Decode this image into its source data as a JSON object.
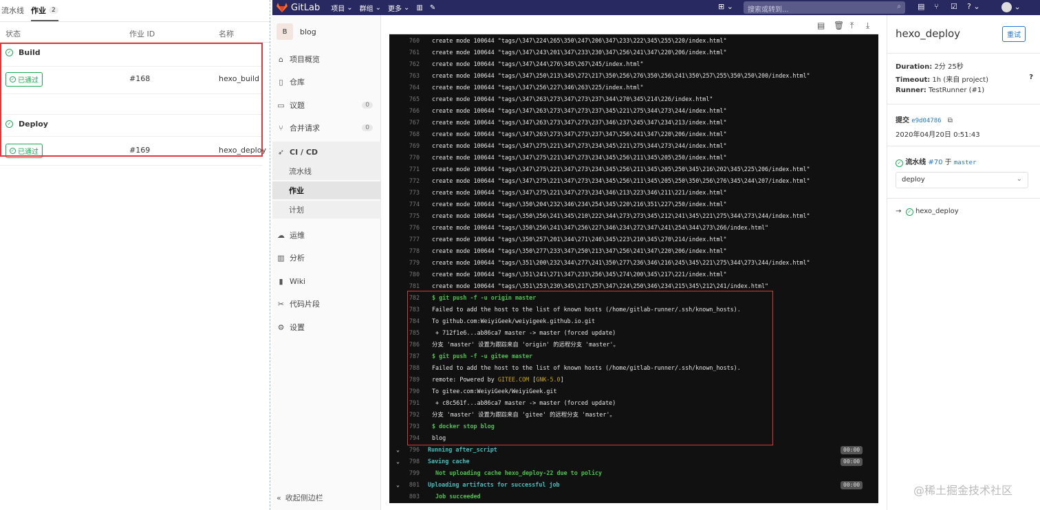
{
  "left": {
    "tabs": [
      {
        "label": "流水线"
      },
      {
        "label": "作业",
        "count": "2"
      }
    ],
    "headers": [
      "状态",
      "作业 ID",
      "名称"
    ],
    "stages": [
      {
        "name": "Build",
        "status": "已通过",
        "job_id": "#168",
        "job_name": "hexo_build"
      },
      {
        "name": "Deploy",
        "status": "已通过",
        "job_id": "#169",
        "job_name": "hexo_deploy"
      }
    ]
  },
  "topbar": {
    "brand": "GitLab",
    "menus": [
      "项目",
      "群组",
      "更多"
    ],
    "search_placeholder": "搜索或转到..."
  },
  "sidebar": {
    "project_initial": "B",
    "project_name": "blog",
    "items": [
      {
        "label": "项目概览",
        "icon": "home-icon"
      },
      {
        "label": "仓库",
        "icon": "doc-icon"
      },
      {
        "label": "议题",
        "icon": "issues-icon",
        "count": "0"
      },
      {
        "label": "合并请求",
        "icon": "merge-request-icon",
        "count": "0"
      },
      {
        "label": "CI / CD",
        "icon": "rocket-icon"
      }
    ],
    "subitems": [
      {
        "label": "流水线"
      },
      {
        "label": "作业"
      },
      {
        "label": "计划"
      }
    ],
    "items2": [
      {
        "label": "运维",
        "icon": "cloud-icon"
      },
      {
        "label": "分析",
        "icon": "chart-icon"
      },
      {
        "label": "Wiki",
        "icon": "book-icon"
      },
      {
        "label": "代码片段",
        "icon": "scissors-icon"
      },
      {
        "label": "设置",
        "icon": "gear-icon"
      }
    ],
    "collapse": "收起侧边栏"
  },
  "log": {
    "lines": [
      {
        "n": "760",
        "t": "create mode 100644 \"tags/\\347\\224\\265\\350\\247\\206\\347\\233\\222\\345\\255\\220/index.html\""
      },
      {
        "n": "761",
        "t": "create mode 100644 \"tags/\\347\\243\\201\\347\\233\\230\\347\\256\\241\\347\\220\\206/index.html\""
      },
      {
        "n": "762",
        "t": "create mode 100644 \"tags/\\347\\244\\276\\345\\267\\245/index.html\""
      },
      {
        "n": "763",
        "t": "create mode 100644 \"tags/\\347\\250\\213\\345\\272\\217\\350\\256\\276\\350\\256\\241\\350\\257\\255\\350\\250\\200/index.html\""
      },
      {
        "n": "764",
        "t": "create mode 100644 \"tags/\\347\\256\\227\\346\\263\\225/index.html\""
      },
      {
        "n": "765",
        "t": "create mode 100644 \"tags/\\347\\263\\273\\347\\273\\237\\344\\270\\345\\214\\226/index.html\""
      },
      {
        "n": "766",
        "t": "create mode 100644 \"tags/\\347\\263\\273\\347\\273\\237\\345\\221\\275\\344\\273\\244/index.html\""
      },
      {
        "n": "767",
        "t": "create mode 100644 \"tags/\\347\\263\\273\\347\\273\\237\\346\\237\\245\\347\\234\\213/index.html\""
      },
      {
        "n": "768",
        "t": "create mode 100644 \"tags/\\347\\263\\273\\347\\273\\237\\347\\256\\241\\347\\220\\206/index.html\""
      },
      {
        "n": "769",
        "t": "create mode 100644 \"tags/\\347\\275\\221\\347\\273\\234\\345\\221\\275\\344\\273\\244/index.html\""
      },
      {
        "n": "770",
        "t": "create mode 100644 \"tags/\\347\\275\\221\\347\\273\\234\\345\\256\\211\\345\\205\\250/index.html\""
      },
      {
        "n": "771",
        "t": "create mode 100644 \"tags/\\347\\275\\221\\347\\273\\234\\345\\256\\211\\345\\205\\250\\345\\216\\202\\345\\225\\206/index.html\""
      },
      {
        "n": "772",
        "t": "create mode 100644 \"tags/\\347\\275\\221\\347\\273\\234\\345\\256\\211\\345\\205\\250\\350\\256\\276\\345\\244\\207/index.html\""
      },
      {
        "n": "773",
        "t": "create mode 100644 \"tags/\\347\\275\\221\\347\\273\\234\\346\\213\\223\\346\\211\\221/index.html\""
      },
      {
        "n": "774",
        "t": "create mode 100644 \"tags/\\350\\204\\232\\346\\234\\254\\345\\220\\216\\351\\227\\250/index.html\""
      },
      {
        "n": "775",
        "t": "create mode 100644 \"tags/\\350\\256\\241\\345\\210\\222\\344\\273\\273\\345\\212\\241\\345\\221\\275\\344\\273\\244/index.html\""
      },
      {
        "n": "776",
        "t": "create mode 100644 \"tags/\\350\\256\\241\\347\\256\\227\\346\\234\\272\\347\\241\\254\\344\\273\\266/index.html\""
      },
      {
        "n": "777",
        "t": "create mode 100644 \"tags/\\350\\257\\201\\344\\271\\246\\345\\223\\210\\345\\270\\214/index.html\""
      },
      {
        "n": "778",
        "t": "create mode 100644 \"tags/\\350\\277\\233\\347\\250\\213\\347\\256\\241\\347\\220\\206/index.html\""
      },
      {
        "n": "779",
        "t": "create mode 100644 \"tags/\\351\\200\\232\\344\\277\\241\\350\\277\\236\\346\\216\\245\\345\\221\\275\\344\\273\\244/index.html\""
      },
      {
        "n": "780",
        "t": "create mode 100644 \"tags/\\351\\241\\271\\347\\233\\256\\345\\274\\200\\345\\217\\221/index.html\""
      },
      {
        "n": "781",
        "t": "create mode 100644 \"tags/\\351\\253\\230\\345\\217\\257\\347\\224\\250\\346\\234\\215\\345\\212\\241/index.html\""
      },
      {
        "n": "782",
        "t": "$ git push -f -u origin master",
        "c": "green"
      },
      {
        "n": "783",
        "t": "Failed to add the host to the list of known hosts (/home/gitlab-runner/.ssh/known_hosts)."
      },
      {
        "n": "784",
        "t": "To github.com:WeiyiGeek/weiyigeek.github.io.git"
      },
      {
        "n": "785",
        "t": " + 712f1e6...ab86ca7 master -> master (forced update)"
      },
      {
        "n": "786",
        "t": "分支 'master' 设置为跟踪来自 'origin' 的远程分支 'master'。"
      },
      {
        "n": "787",
        "t": "$ git push -f -u gitee master",
        "c": "green"
      },
      {
        "n": "788",
        "t": "Failed to add the host to the list of known hosts (/home/gitlab-runner/.ssh/known_hosts)."
      },
      {
        "n": "789",
        "t": "remote: Powered by ",
        "t2": "GITEE.COM",
        "t3": " [",
        "t4": "GNK-5.0",
        "t5": "]"
      },
      {
        "n": "790",
        "t": "To gitee.com:WeiyiGeek/WeiyiGeek.git"
      },
      {
        "n": "791",
        "t": " + c8c561f...ab86ca7 master -> master (forced update)"
      },
      {
        "n": "792",
        "t": "分支 'master' 设置为跟踪来自 'gitee' 的远程分支 'master'。"
      },
      {
        "n": "793",
        "t": "$ docker stop blog",
        "c": "green"
      },
      {
        "n": "794",
        "t": "blog"
      },
      {
        "n": "796",
        "t": "Running after_script",
        "c": "cyan",
        "chev": true,
        "time": "00:00"
      },
      {
        "n": "798",
        "t": "Saving cache",
        "c": "cyan",
        "chev": true,
        "time": "00:00"
      },
      {
        "n": "799",
        "t": " Not uploading cache hexo_deploy-22 due to policy",
        "c": "green"
      },
      {
        "n": "801",
        "t": "Uploading artifacts for successful job",
        "c": "cyan",
        "chev": true,
        "time": "00:00"
      },
      {
        "n": "803",
        "t": " Job succeeded",
        "c": "green"
      }
    ]
  },
  "right": {
    "title": "hexo_deploy",
    "retry": "重试",
    "duration_label": "Duration:",
    "duration": "2分 25秒",
    "timeout_label": "Timeout:",
    "timeout": "1h (来自 project)",
    "runner_label": "Runner:",
    "runner": "TestRunner (#1)",
    "commit_label": "提交",
    "commit": "e9d04786",
    "date": "2020年04月20日 0:51:43",
    "pipeline_label": "流水线",
    "pipeline": "#70",
    "pipeline_on": "于",
    "branch": "master",
    "stage_select": "deploy",
    "current_job": "hexo_deploy"
  },
  "watermark": "@稀土掘金技术社区"
}
